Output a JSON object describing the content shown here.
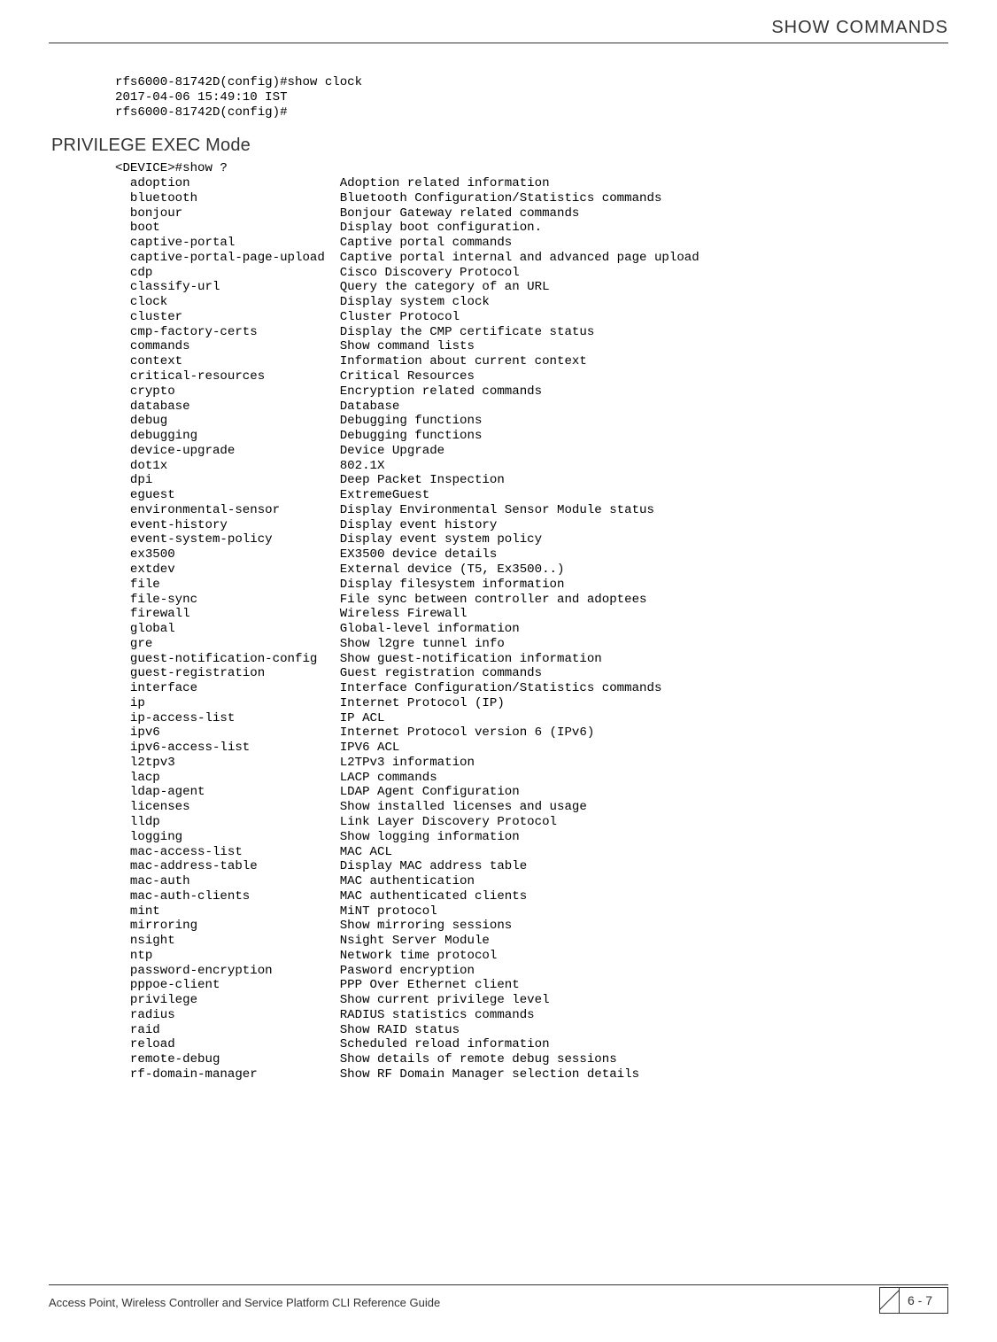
{
  "header": {
    "title": "SHOW COMMANDS"
  },
  "intro": {
    "line1": "rfs6000-81742D(config)#show clock",
    "line2": "2017-04-06 15:49:10 IST",
    "line3": "rfs6000-81742D(config)#"
  },
  "section_heading": "PRIVILEGE EXEC Mode",
  "prompt": "<DEVICE>#show ?",
  "commands": [
    {
      "cmd": "adoption",
      "desc": "Adoption related information"
    },
    {
      "cmd": "bluetooth",
      "desc": "Bluetooth Configuration/Statistics commands"
    },
    {
      "cmd": "bonjour",
      "desc": "Bonjour Gateway related commands"
    },
    {
      "cmd": "boot",
      "desc": "Display boot configuration."
    },
    {
      "cmd": "captive-portal",
      "desc": "Captive portal commands"
    },
    {
      "cmd": "captive-portal-page-upload",
      "desc": "Captive portal internal and advanced page upload"
    },
    {
      "cmd": "cdp",
      "desc": "Cisco Discovery Protocol"
    },
    {
      "cmd": "classify-url",
      "desc": "Query the category of an URL"
    },
    {
      "cmd": "clock",
      "desc": "Display system clock"
    },
    {
      "cmd": "cluster",
      "desc": "Cluster Protocol"
    },
    {
      "cmd": "cmp-factory-certs",
      "desc": "Display the CMP certificate status"
    },
    {
      "cmd": "commands",
      "desc": "Show command lists"
    },
    {
      "cmd": "context",
      "desc": "Information about current context"
    },
    {
      "cmd": "critical-resources",
      "desc": "Critical Resources"
    },
    {
      "cmd": "crypto",
      "desc": "Encryption related commands"
    },
    {
      "cmd": "database",
      "desc": "Database"
    },
    {
      "cmd": "debug",
      "desc": "Debugging functions"
    },
    {
      "cmd": "debugging",
      "desc": "Debugging functions"
    },
    {
      "cmd": "device-upgrade",
      "desc": "Device Upgrade"
    },
    {
      "cmd": "dot1x",
      "desc": "802.1X"
    },
    {
      "cmd": "dpi",
      "desc": "Deep Packet Inspection"
    },
    {
      "cmd": "eguest",
      "desc": "ExtremeGuest"
    },
    {
      "cmd": "environmental-sensor",
      "desc": "Display Environmental Sensor Module status"
    },
    {
      "cmd": "event-history",
      "desc": "Display event history"
    },
    {
      "cmd": "event-system-policy",
      "desc": "Display event system policy"
    },
    {
      "cmd": "ex3500",
      "desc": "EX3500 device details"
    },
    {
      "cmd": "extdev",
      "desc": "External device (T5, Ex3500..)"
    },
    {
      "cmd": "file",
      "desc": "Display filesystem information"
    },
    {
      "cmd": "file-sync",
      "desc": "File sync between controller and adoptees"
    },
    {
      "cmd": "firewall",
      "desc": "Wireless Firewall"
    },
    {
      "cmd": "global",
      "desc": "Global-level information"
    },
    {
      "cmd": "gre",
      "desc": "Show l2gre tunnel info"
    },
    {
      "cmd": "guest-notification-config",
      "desc": "Show guest-notification information"
    },
    {
      "cmd": "guest-registration",
      "desc": "Guest registration commands"
    },
    {
      "cmd": "interface",
      "desc": "Interface Configuration/Statistics commands"
    },
    {
      "cmd": "ip",
      "desc": "Internet Protocol (IP)"
    },
    {
      "cmd": "ip-access-list",
      "desc": "IP ACL"
    },
    {
      "cmd": "ipv6",
      "desc": "Internet Protocol version 6 (IPv6)"
    },
    {
      "cmd": "ipv6-access-list",
      "desc": "IPV6 ACL"
    },
    {
      "cmd": "l2tpv3",
      "desc": "L2TPv3 information"
    },
    {
      "cmd": "lacp",
      "desc": "LACP commands"
    },
    {
      "cmd": "ldap-agent",
      "desc": "LDAP Agent Configuration"
    },
    {
      "cmd": "licenses",
      "desc": "Show installed licenses and usage"
    },
    {
      "cmd": "lldp",
      "desc": "Link Layer Discovery Protocol"
    },
    {
      "cmd": "logging",
      "desc": "Show logging information"
    },
    {
      "cmd": "mac-access-list",
      "desc": "MAC ACL"
    },
    {
      "cmd": "mac-address-table",
      "desc": "Display MAC address table"
    },
    {
      "cmd": "mac-auth",
      "desc": "MAC authentication"
    },
    {
      "cmd": "mac-auth-clients",
      "desc": "MAC authenticated clients"
    },
    {
      "cmd": "mint",
      "desc": "MiNT protocol"
    },
    {
      "cmd": "mirroring",
      "desc": "Show mirroring sessions"
    },
    {
      "cmd": "nsight",
      "desc": "Nsight Server Module"
    },
    {
      "cmd": "ntp",
      "desc": "Network time protocol"
    },
    {
      "cmd": "password-encryption",
      "desc": "Pasword encryption"
    },
    {
      "cmd": "pppoe-client",
      "desc": "PPP Over Ethernet client"
    },
    {
      "cmd": "privilege",
      "desc": "Show current privilege level"
    },
    {
      "cmd": "radius",
      "desc": "RADIUS statistics commands"
    },
    {
      "cmd": "raid",
      "desc": "Show RAID status"
    },
    {
      "cmd": "reload",
      "desc": "Scheduled reload information"
    },
    {
      "cmd": "remote-debug",
      "desc": "Show details of remote debug sessions"
    },
    {
      "cmd": "rf-domain-manager",
      "desc": "Show RF Domain Manager selection details"
    }
  ],
  "footer": {
    "text": "Access Point, Wireless Controller and Service Platform CLI Reference Guide",
    "page": "6 - 7"
  }
}
